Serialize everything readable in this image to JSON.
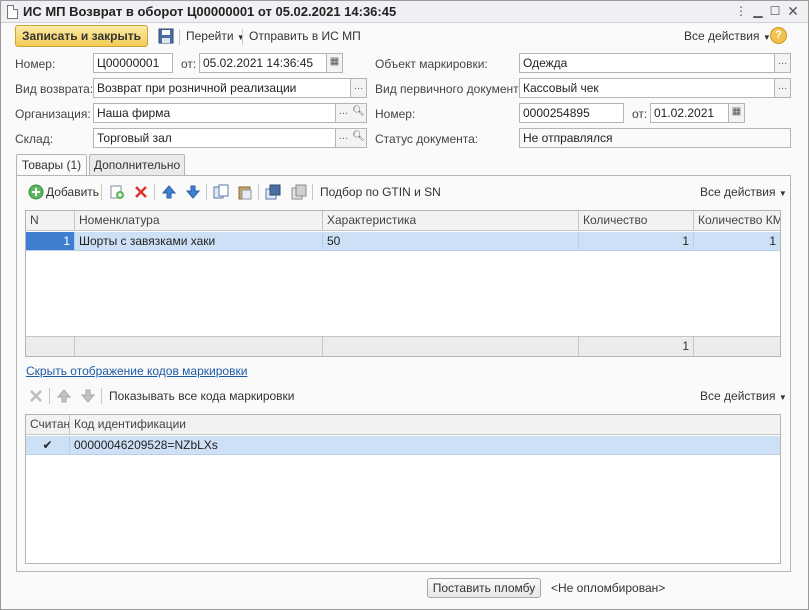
{
  "window": {
    "title": "ИС МП Возврат в оборот Ц00000001 от 05.02.2021 14:36:45"
  },
  "toolbar": {
    "save_close_label": "Записать и закрыть",
    "goto_label": "Перейти",
    "send_label": "Отправить в ИС МП",
    "all_actions_label": "Все действия",
    "help_label": "?"
  },
  "form": {
    "number_label": "Номер:",
    "number_value": "Ц00000001",
    "from_label": "от:",
    "date_value": "05.02.2021 14:36:45",
    "return_type_label": "Вид возврата:",
    "return_type_value": "Возврат при розничной реализации",
    "org_label": "Организация:",
    "org_value": "Наша фирма",
    "warehouse_label": "Склад:",
    "warehouse_value": "Торговый зал",
    "marking_object_label": "Объект маркировки:",
    "marking_object_value": "Одежда",
    "primary_doc_type_label": "Вид первичного документа:",
    "primary_doc_type_value": "Кассовый чек",
    "primary_number_label": "Номер:",
    "primary_number_value": "0000254895",
    "primary_from_label": "от:",
    "primary_date_value": "01.02.2021",
    "status_label": "Статус документа:",
    "status_value": "Не отправлялся"
  },
  "tabs": [
    {
      "label": "Товары (1)"
    },
    {
      "label": "Дополнительно"
    }
  ],
  "goods": {
    "add_label": "Добавить",
    "pick_label": "Подбор по GTIN и SN",
    "all_actions_label": "Все действия",
    "columns": [
      "N",
      "Номенклатура",
      "Характеристика",
      "Количество",
      "Количество КМ"
    ],
    "rows": [
      {
        "n": "1",
        "item": "Шорты с завязками хаки",
        "characteristic": "50",
        "qty": "1",
        "qty_km": "1"
      }
    ],
    "total_qty": "1"
  },
  "hide_codes_link": "Скрыть отображение кодов маркировки",
  "codes": {
    "show_all_label": "Показывать все кода маркировки",
    "all_actions_label": "Все действия",
    "columns": [
      "Считан",
      "Код идентификации"
    ],
    "rows": [
      {
        "scanned": "✔",
        "code": "00000046209528=NZbLXs"
      }
    ]
  },
  "bottom": {
    "seal_button": "Поставить пломбу",
    "seal_status": "<Не опломбирован>"
  }
}
